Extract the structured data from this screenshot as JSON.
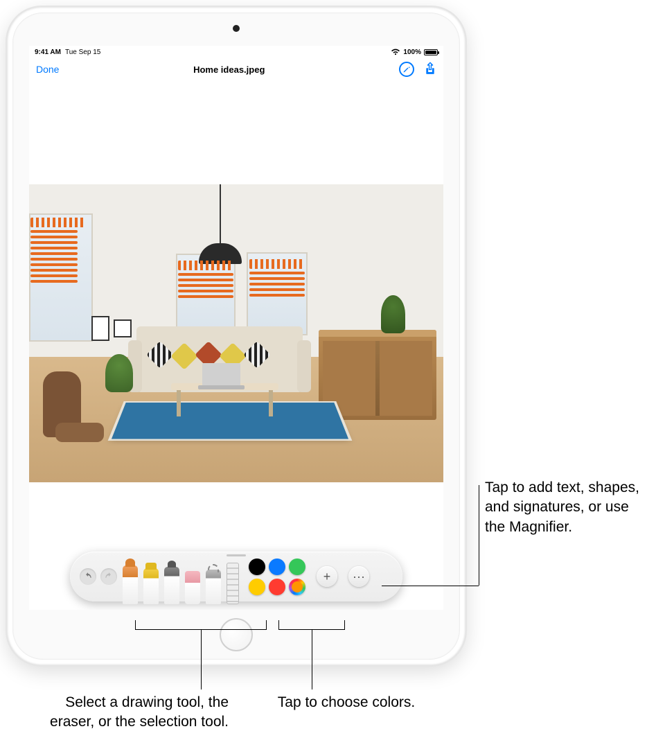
{
  "statusbar": {
    "time": "9:41 AM",
    "date": "Tue Sep 15",
    "battery_pct": "100%"
  },
  "navbar": {
    "done_label": "Done",
    "title": "Home ideas.jpeg"
  },
  "toolbar": {
    "undo_icon": "undo-icon",
    "redo_icon": "redo-icon",
    "tools": [
      "pen",
      "marker",
      "pencil",
      "eraser",
      "lasso",
      "ruler"
    ],
    "colors": {
      "black": "#000000",
      "blue": "#0a7aff",
      "green": "#35c759",
      "yellow": "#ffcc00",
      "red": "#ff3b30",
      "multicolor_center": "#ff9500"
    },
    "add_label": "+",
    "more_label": "···"
  },
  "callouts": {
    "add": "Tap to add text, shapes, and signatures, or use the Magnifier.",
    "tools": "Select a drawing tool, the eraser, or the selection tool.",
    "colors": "Tap to choose colors."
  }
}
